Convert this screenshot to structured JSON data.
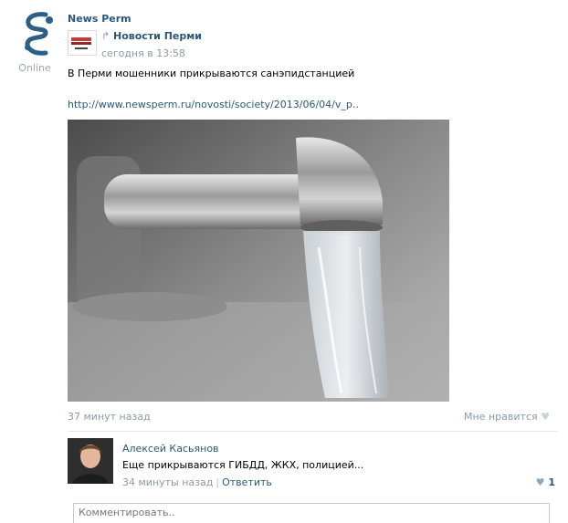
{
  "post": {
    "author": "News Perm",
    "online_label": "Online",
    "repost_source": "Новости Перми",
    "repost_time": "сегодня в 13:58",
    "text": "В Перми мошенники прикрываются санэпидстанцией",
    "link": "http://www.newsperm.ru/novosti/society/2013/06/04/v_p..",
    "time_ago": "37 минут назад",
    "like_label": "Мне нравится"
  },
  "comment": {
    "author": "Алексей Касьянов",
    "text": "Еще прикрываются ГИБДД, ЖКХ, полицией...",
    "time": "34 минуты назад",
    "reply_label": "Ответить",
    "likes": "1"
  },
  "comment_input": {
    "placeholder": "Комментировать.."
  },
  "icons": {
    "repost": "repost-arrow-icon",
    "like": "heart-icon"
  },
  "colors": {
    "link": "#2b587a",
    "muted": "#8a9aaa"
  }
}
